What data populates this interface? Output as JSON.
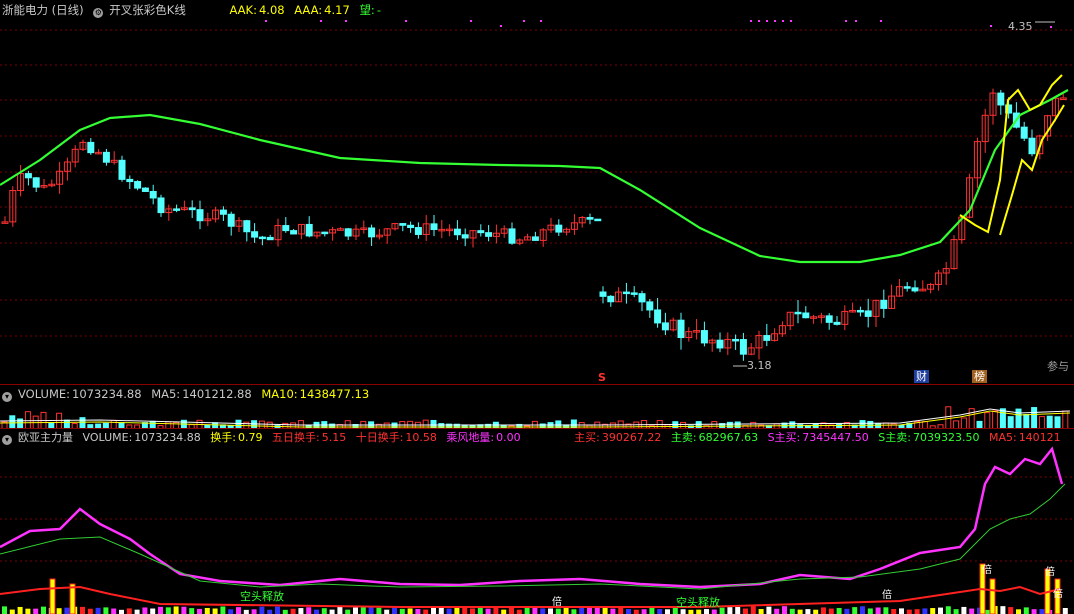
{
  "main": {
    "title": "浙能电力 (日线)",
    "indicator": "开叉张彩色K线",
    "aak_label": "AAK:",
    "aak_value": "4.08",
    "aaa_label": "AAA:",
    "aaa_value": "4.17",
    "wang_label": "望:",
    "wang_value": "-",
    "high_price_label": "4.35",
    "low_price_label": "3.18",
    "s_marker": "S",
    "cai_marker": "财",
    "bang_marker": "榜",
    "ref_label": "参与"
  },
  "volume_panel": {
    "label": "VOLUME:",
    "value": "1073234.88",
    "ma5_label": "MA5:",
    "ma5_value": "1401212.88",
    "ma10_label": "MA10:",
    "ma10_value": "1438477.13"
  },
  "indicator_panel": {
    "name": "欧亚主力量",
    "volume_label": "VOLUME:",
    "volume_value": "1073234.88",
    "huanshou_label": "换手:",
    "huanshou_value": "0.79",
    "wuri_label": "五日换手:",
    "wuri_value": "5.15",
    "shiri_label": "十日换手:",
    "shiri_value": "10.58",
    "chengfeng_label": "乘风地量:",
    "chengfeng_value": "0.00",
    "zhumai1_label": "主买:",
    "zhumai1_value": "390267.22",
    "zhumai2_label": "主卖:",
    "zhumai2_value": "682967.63",
    "s_zhumai_label": "S主买:",
    "s_zhumai_value": "7345447.50",
    "s_zhumai2_label": "S主卖:",
    "s_zhumai2_value": "7039323.50",
    "ma5_label": "MA5:",
    "ma5_value": "140121",
    "kongtou1": "空头释放",
    "kongtou2": "空头释放",
    "bei1": "倍",
    "bei2": "倍",
    "bei3": "倍",
    "bei4": "倍",
    "bei5": "倍"
  },
  "colors": {
    "up": "#ff3232",
    "down": "#54ffff",
    "ma_green": "#33ff33",
    "ma_yellow": "#ffff00",
    "magenta": "#ff33ff"
  }
}
